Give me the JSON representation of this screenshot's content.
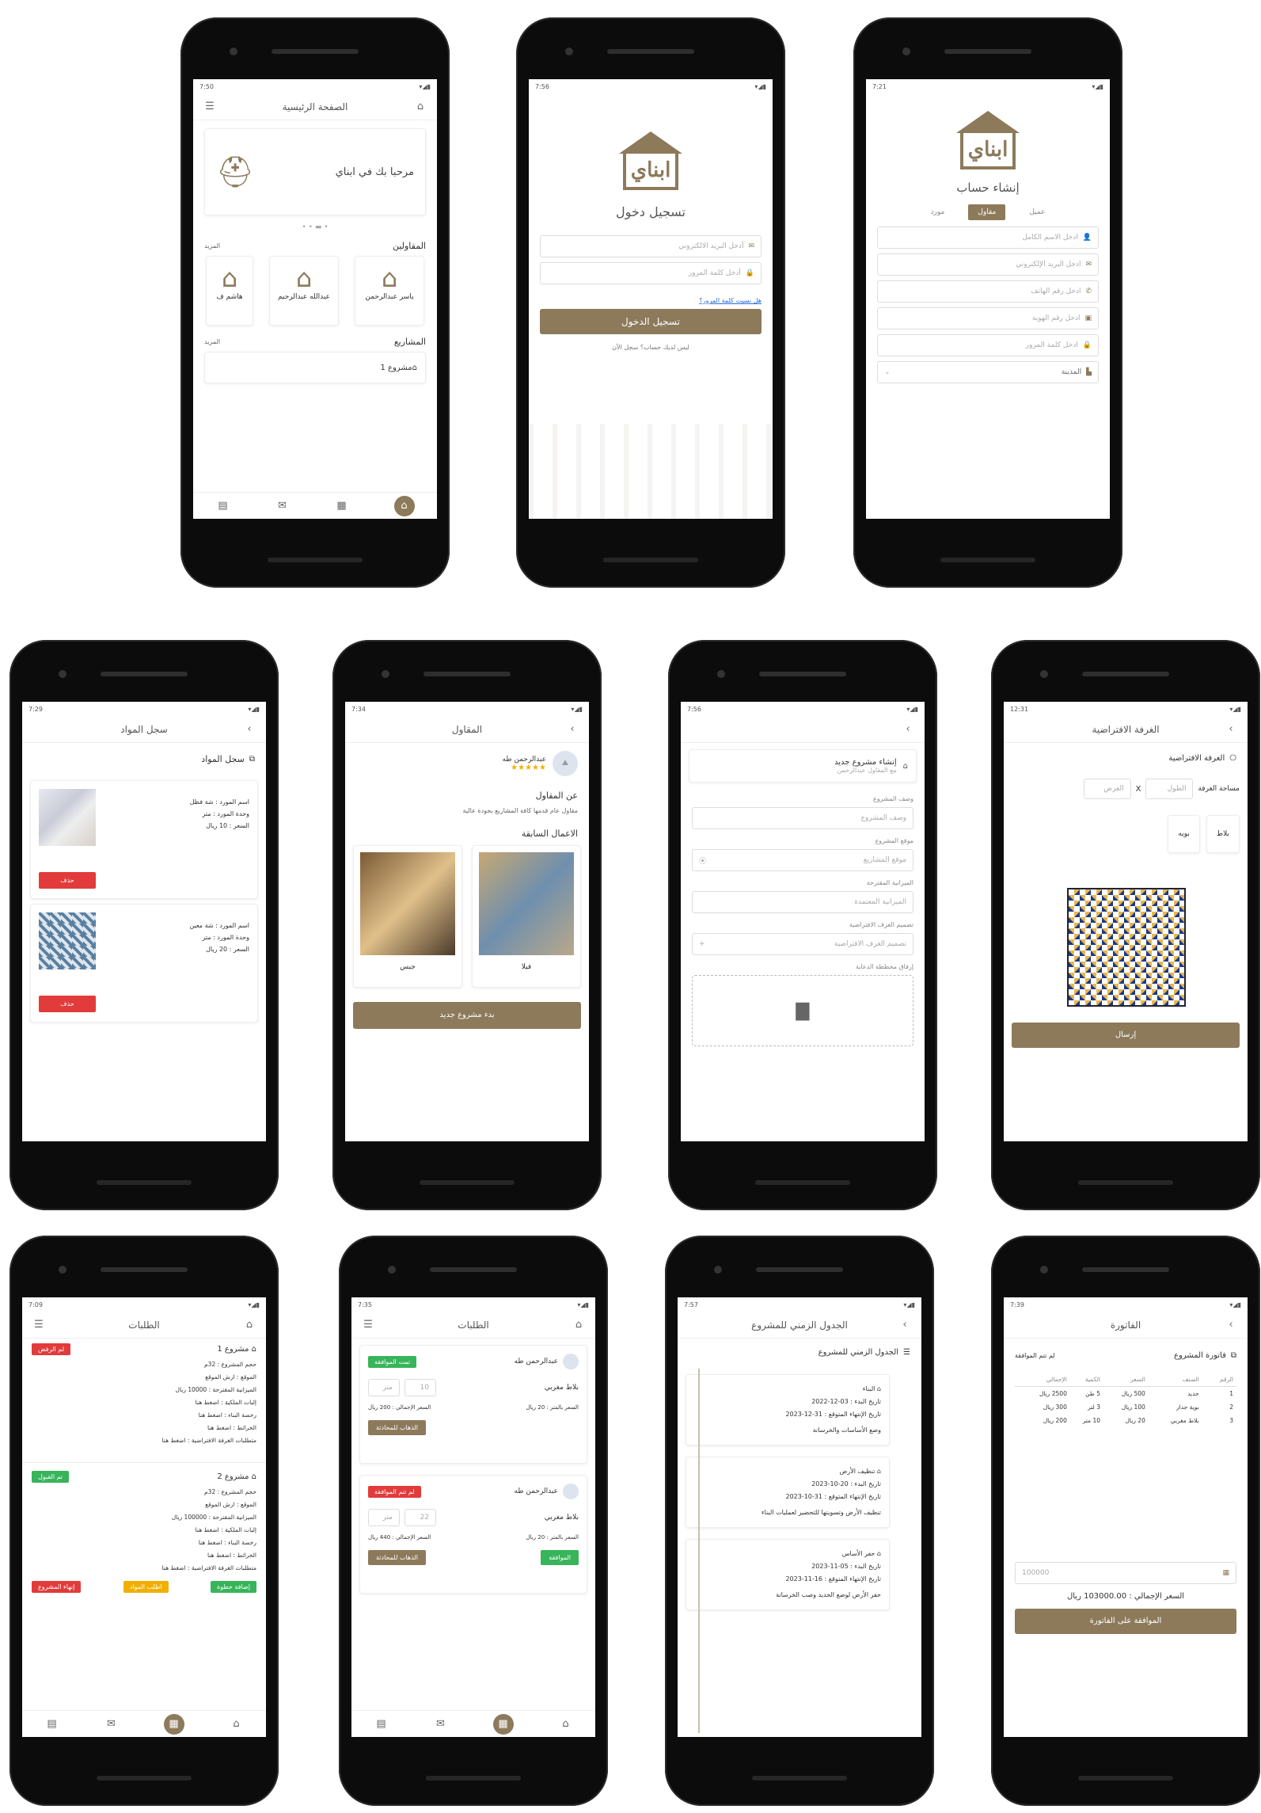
{
  "status_times": {
    "home": "7:50",
    "login": "7:56",
    "register": "7:21",
    "materials": "7:29",
    "contractor": "7:34",
    "newproject": "7:56",
    "virtualroom": "12:31",
    "orders1": "7:09",
    "orders2": "7:35",
    "timeline": "7:57",
    "invoice": "7:39"
  },
  "brand": {
    "name": "ابناي",
    "accent": "#8c7a5b"
  },
  "home": {
    "title": "الصفحة الرئيسية",
    "welcome": "مرحبا بك في ابناي",
    "contractors_section": "المقاولين",
    "more": "المزيد",
    "contractors": [
      "ياسر عبدالرحمن",
      "عبدالله عبدالرحيم",
      "هاشم ف"
    ],
    "projects_section": "المشاريع",
    "project_item": "مشروع 1"
  },
  "login": {
    "title": "تسجيل دخول",
    "email_ph": "أدخل البريد الالكتروني",
    "password_ph": "أدخل كلمة المرور",
    "forgot": "هل نسيت كلمة المرور؟",
    "submit": "تسجيل الدخول",
    "no_account": "ليس لديك حساب؟ سجل الآن"
  },
  "register": {
    "title": "إنشاء حساب",
    "tabs": [
      "عميل",
      "مقاول",
      "مورد"
    ],
    "fields": [
      "ادخل الاسم الكامل",
      "ادخل البريد الإلكتروني",
      "ادخل رقم الهاتف",
      "ادخل رقم الهوية",
      "ادخل كلمة المرور"
    ],
    "city": "المدينة"
  },
  "materials": {
    "title": "سجل المواد",
    "section": "سجل المواد",
    "items": [
      {
        "name": "اسم المورد : شة فظل",
        "unit": "وحدة المورد : متر",
        "price": "السعر : 10 ريال"
      },
      {
        "name": "اسم المورد : شة معين",
        "unit": "وحدة المورد : متر",
        "price": "السعر : 20 ريال"
      }
    ],
    "delete": "حذف"
  },
  "contractor": {
    "title": "المقاول",
    "name": "عبدالرحمن طه",
    "stars": "★★★★★",
    "about_h": "عن المقاول",
    "about": "مقاول عام قدمها كافة المشاريع بجودة عالية",
    "prev_h": "الاعمال السابقة",
    "works": [
      "فيلا",
      "جبس"
    ],
    "new_project": "بدء مشروع جديد"
  },
  "newproject": {
    "title": "إنشاء مشروع جديد",
    "subtitle": "مع المقاول عبدالرحمن",
    "labels": [
      "وصف المشروع",
      "موقع المشروع",
      "الميزانية المقترحة",
      "تصميم الغرف الافتراضية",
      "إرفاق مخططة الدعاية"
    ],
    "placeholders": [
      "وصف المشروع",
      "موقع المشاريع",
      "الميزانية المعتمدة",
      "تصميم الغرف الافتراضية"
    ]
  },
  "virtualroom": {
    "title": "الغرفة الافتراضية",
    "section": "الغرفة الافتراضية",
    "area_label": "مساحة الغرفة",
    "length": "الطول",
    "width": "العرض",
    "options": [
      "بلاط",
      "بويه"
    ],
    "send": "إرسال"
  },
  "orders1": {
    "title": "الطلبات",
    "p1": {
      "name": "مشروع 1",
      "status": "لم الرفض",
      "lines": [
        "حجم المشروع : 32م",
        "الموقع : ارش الموقع",
        "الميزانية المقترحة : 10000 ريال",
        "إلبات الملكية : اضغط هنا",
        "رخصة البناء : اضغط هنا",
        "الخرائط : اضغط هنا",
        "متطلبات الغرفة الافتراضية : اضغط هنا"
      ]
    },
    "p2": {
      "name": "مشروع 2",
      "status": "تم القبول",
      "lines": [
        "حجم المشروع : 32م",
        "الموقع : ارش الموقع",
        "الميزانية المقترحة : 100000 ريال",
        "إلبات الملكية : اضغط هنا",
        "رخصة البناء : اضغط هنا",
        "الخرائط : اضغط هنا",
        "متطلبات الغرفة الافتراضية : اضغط هنا"
      ]
    },
    "actions": [
      "إضافة خطوة",
      "اطلب المواد",
      "إنهاء المشروع"
    ]
  },
  "orders2": {
    "title": "الطلبات",
    "o1": {
      "name": "عبدالرحمن طه",
      "status": "تمت الموافقة",
      "item": "بلاط مغربي",
      "qty": "10",
      "unit": "متر",
      "unit_price": "السعر بالمتر : 20 ريال",
      "total": "السعر الإجمالي : 200 ريال",
      "action": "الذهاب للمحادثة"
    },
    "o2": {
      "name": "عبدالرحمن طه",
      "status": "لم تتم الموافقة",
      "item": "بلاط مغربي",
      "qty": "22",
      "unit": "متر",
      "unit_price": "السعر بالمتر : 20 ريال",
      "total": "السعر الإجمالي : 440 ريال",
      "approve": "الموافقة",
      "chat": "الذهاب للمحادثة"
    }
  },
  "timeline": {
    "title": "الجدول الزمني للمشروع",
    "section": "الجدول الزمني للمشروع",
    "steps": [
      {
        "name": "البناء",
        "start": "تاريخ البدء : 03-12-2022",
        "end": "تاريخ الإنتهاء المتوقع : 31-12-2023",
        "desc": "وضع الأساسات والخرسانة"
      },
      {
        "name": "تنظيف الأرض",
        "start": "تاريخ البدء : 20-10-2023",
        "end": "تاريخ الإنتهاء المتوقع : 31-10-2023",
        "desc": "تنظيف الأرض وتسويتها للتحضير لعمليات البناء"
      },
      {
        "name": "حفر الأساس",
        "start": "تاريخ البدء : 05-11-2023",
        "end": "تاريخ الإنتهاء المتوقع : 16-11-2023",
        "desc": "حفر الأرض لوضع الحديد وصب الخرسانة"
      }
    ]
  },
  "invoice": {
    "title": "الفاتورة",
    "section": "فاتورة المشروع",
    "status": "لم تتم الموافقة",
    "headers": [
      "الرقم",
      "الصنف",
      "السعر",
      "الكمية",
      "الإجمالي"
    ],
    "rows": [
      [
        "1",
        "حديد",
        "500 ريال",
        "5 طن",
        "2500 ريال"
      ],
      [
        "2",
        "بوية جدار",
        "100 ريال",
        "3 لتر",
        "300 ريال"
      ],
      [
        "3",
        "بلاط مغربي",
        "20 ريال",
        "10 متر",
        "200 ريال"
      ]
    ],
    "input_ph": "100000",
    "total": "السعر الإجمالي : 103000.00 ريال",
    "approve": "الموافقة على الفاتورة"
  }
}
